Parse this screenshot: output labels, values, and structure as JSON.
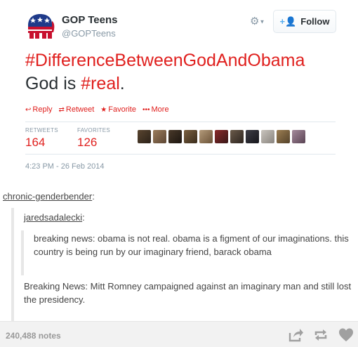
{
  "tweet": {
    "display_name": "GOP Teens",
    "handle": "@GOPTeens",
    "follow_label": "Follow",
    "hashtag_line": "#DifferenceBetweenGodAndObama",
    "text_prefix": "God is ",
    "text_hashtag": "#real",
    "text_suffix": ".",
    "actions": {
      "reply": "Reply",
      "retweet": "Retweet",
      "favorite": "Favorite",
      "more": "More"
    },
    "stats": {
      "retweets_label": "RETWEETS",
      "retweets_value": "164",
      "favorites_label": "FAVORITES",
      "favorites_value": "126"
    },
    "timestamp": "4:23 PM - 26 Feb 2014",
    "colors": {
      "accent": "#e0201e",
      "muted": "#8899a6"
    }
  },
  "thread": {
    "user_1": "chronic-genderbender",
    "user_2": "jaredsadalecki",
    "quote_text": "breaking news: obama is not real. obama is a figment of our imaginations. this country is being run by our imaginary friend, barack obama",
    "reply_2": "Breaking News: Mitt Romney campaigned against an imaginary man and still lost the presidency."
  },
  "footer": {
    "notes": "240,488 notes",
    "icons": [
      "share-icon",
      "reblog-icon",
      "like-icon"
    ]
  }
}
